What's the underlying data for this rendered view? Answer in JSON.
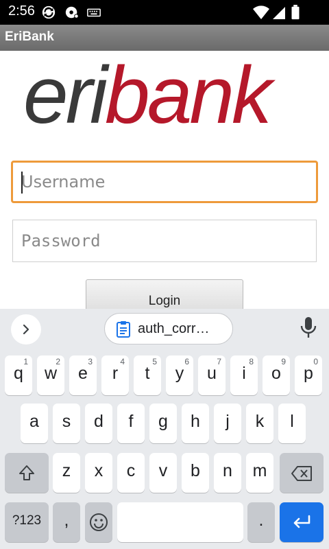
{
  "status_bar": {
    "time": "2:56",
    "icons": [
      "sync-icon",
      "disc-icon",
      "keyboard-icon",
      "wifi-icon",
      "signal-icon",
      "battery-icon"
    ]
  },
  "app_bar": {
    "title": "EriBank"
  },
  "logo": {
    "part1": "eri",
    "part2": "bank",
    "colors": {
      "part1": "#3a3a3a",
      "part2": "#b5182a"
    }
  },
  "form": {
    "username": {
      "value": "",
      "placeholder": "Username",
      "focused": true,
      "focus_color": "#ee9a3a"
    },
    "password": {
      "value": "",
      "placeholder": "Password"
    },
    "login_label": "Login"
  },
  "keyboard": {
    "toolbar": {
      "expand_icon": "chevron-right-icon",
      "clipboard_text": "auth_corr…",
      "clipboard_icon": "clipboard-icon",
      "mic_icon": "mic-icon"
    },
    "row1": [
      {
        "k": "q",
        "h": "1"
      },
      {
        "k": "w",
        "h": "2"
      },
      {
        "k": "e",
        "h": "3"
      },
      {
        "k": "r",
        "h": "4"
      },
      {
        "k": "t",
        "h": "5"
      },
      {
        "k": "y",
        "h": "6"
      },
      {
        "k": "u",
        "h": "7"
      },
      {
        "k": "i",
        "h": "8"
      },
      {
        "k": "o",
        "h": "9"
      },
      {
        "k": "p",
        "h": "0"
      }
    ],
    "row2": [
      "a",
      "s",
      "d",
      "f",
      "g",
      "h",
      "j",
      "k",
      "l"
    ],
    "row3": [
      "z",
      "x",
      "c",
      "v",
      "b",
      "n",
      "m"
    ],
    "row4": {
      "symbols_label": "?123",
      "comma": ",",
      "period": "."
    },
    "accent_color": "#1a73e8"
  }
}
